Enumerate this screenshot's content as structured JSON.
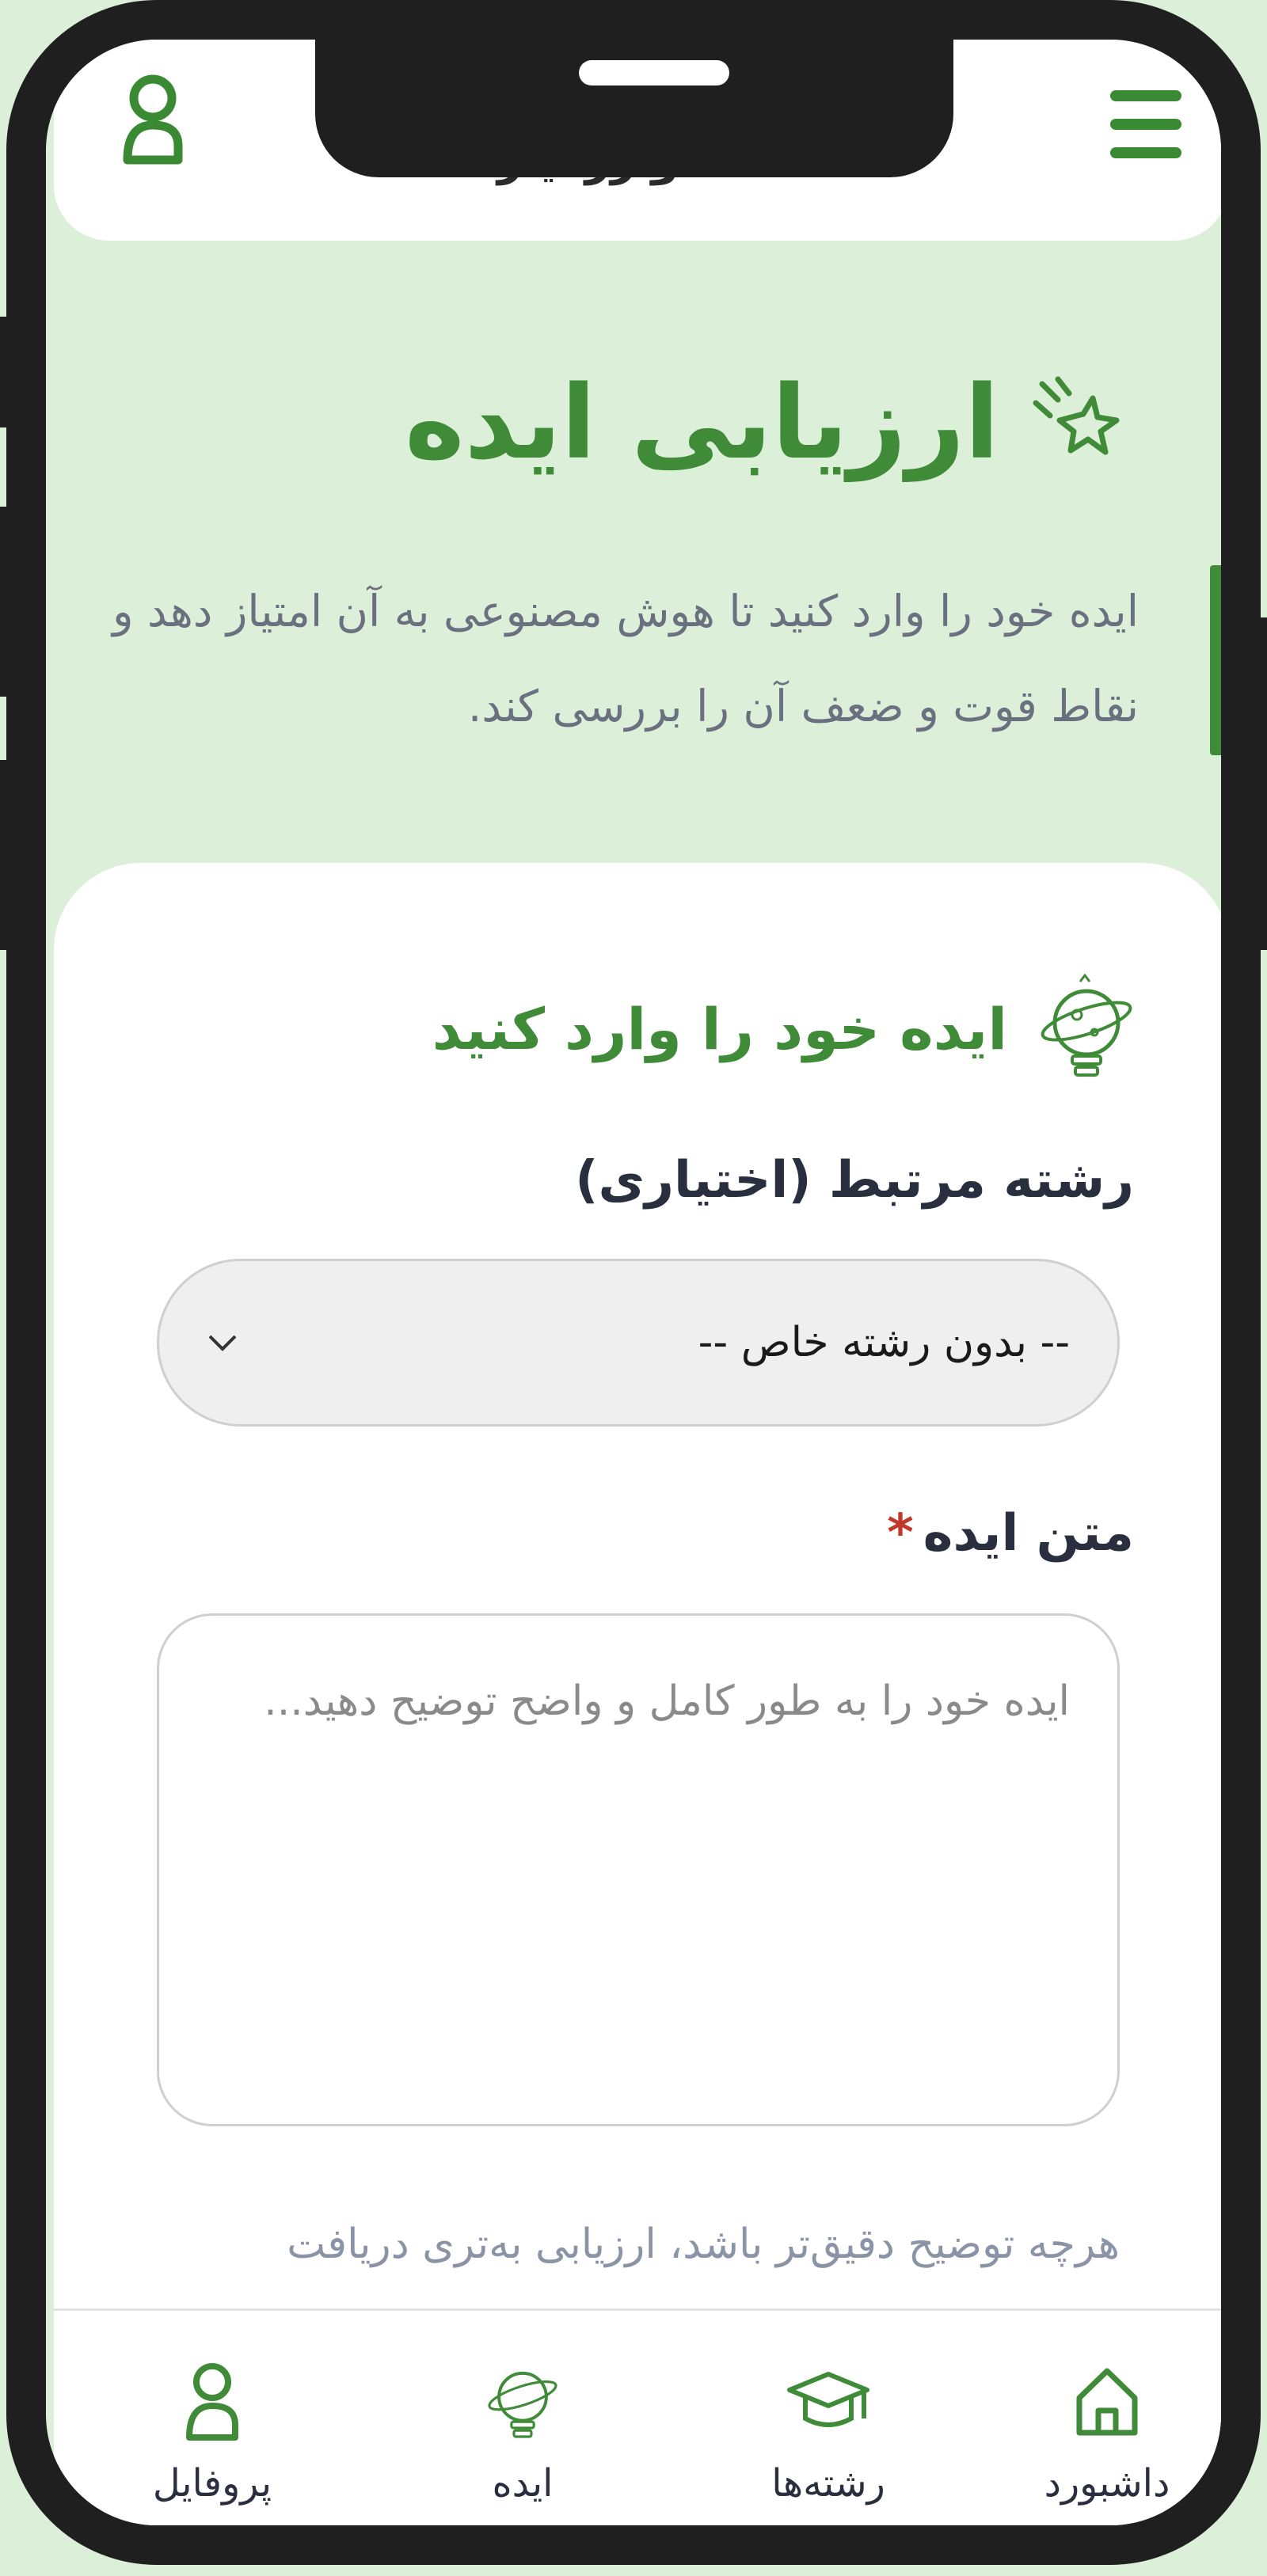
{
  "app": {
    "brand_name": "خوارزمیار"
  },
  "hero": {
    "title": "ارزیابی ایده",
    "description": "ایده خود را وارد کنید تا هوش مصنوعی به آن امتیاز دهد و نقاط قوت و ضعف آن را بررسی کند."
  },
  "form": {
    "card_title": "ایده خود را وارد کنید",
    "field_label": "رشته مرتبط (اختیاری)",
    "field_selected": "-- بدون رشته خاص --",
    "text_label": "متن ایده",
    "required_mark": "*",
    "text_placeholder": "ایده خود را به طور کامل و واضح توضیح دهید...",
    "hint": "هرچه توضیح دقیق‌تر باشد، ارزیابی به‌تری دریافت می‌کنید."
  },
  "tabs": [
    {
      "label": "داشبورد",
      "icon": "home-icon"
    },
    {
      "label": "رشته‌ها",
      "icon": "graduation-cap-icon"
    },
    {
      "label": "ایده",
      "icon": "idea-bulb-icon"
    },
    {
      "label": "پروفایل",
      "icon": "user-icon"
    }
  ],
  "colors": {
    "accent": "#3f8b38",
    "background": "#dcefd8",
    "frame": "#1e1f1e"
  }
}
